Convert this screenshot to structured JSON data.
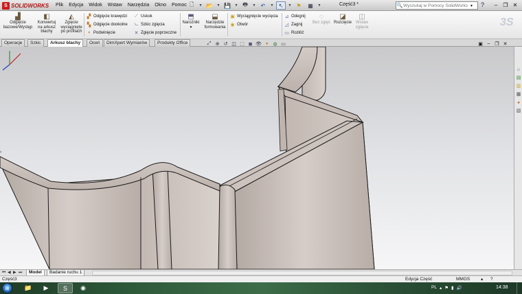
{
  "app": {
    "logo_text": "SOLIDWORKS",
    "document_title": "Część3 *",
    "menu": [
      "Plik",
      "Edycja",
      "Widok",
      "Wstaw",
      "Narzędzia",
      "Okno",
      "Pomoc"
    ],
    "help_icon": "question-icon",
    "window_controls": [
      "minimize-icon",
      "restore-icon",
      "close-icon"
    ]
  },
  "search": {
    "placeholder": "Wyszukaj w Pomocy SolidWorks"
  },
  "ribbon": {
    "big_buttons": [
      {
        "label": "Odgięcie\nbazowe/Występ",
        "icon": "base-flange-icon",
        "enabled": true
      },
      {
        "label": "Konwertuj\nna arkusz\nblachy",
        "icon": "convert-sheet-icon",
        "enabled": true
      },
      {
        "label": "Zgięcie\nwyciągnięte\npo profilach",
        "icon": "lofted-bend-icon",
        "enabled": true
      }
    ],
    "col1": [
      "Odgięcie krawędzi",
      "Odgięcie dookolne",
      "Podwinięcie"
    ],
    "col2": [
      "Uskok",
      "Szkic zgięcia",
      "Zgięcie poprzeczne"
    ],
    "corners_label": "Narożniki",
    "forming_label": "Narzędzie\nformowania",
    "col3": [
      "Wyciągnięcie wycięcia",
      "Otwór"
    ],
    "col4": [
      "Odegnij",
      "Zagnij",
      "Rozłóż"
    ],
    "no_bends_label": "Bez zgięć",
    "rip_label": "Rozcięcie",
    "insert_bends_label": "Wstaw\nzgięcia"
  },
  "tabs": {
    "items": [
      "Operacje",
      "Szkic",
      "Arkusz blachy",
      "Oceń",
      "DimXpert Wymiarów",
      "Produkty Office"
    ],
    "active": "Arkusz blachy"
  },
  "bottom_tabs": {
    "items": [
      "Model",
      "Badanie ruchu 1"
    ],
    "active": "Model"
  },
  "status": {
    "part_name": "Część3",
    "mode": "Edycja Część",
    "units": "MMGS"
  },
  "taskbar": {
    "language": "PL",
    "clock": "14:38"
  },
  "colors": {
    "metal_face": "#c5bab4",
    "metal_edge": "#1a1a1a",
    "logo_red": "#c81e1e"
  }
}
